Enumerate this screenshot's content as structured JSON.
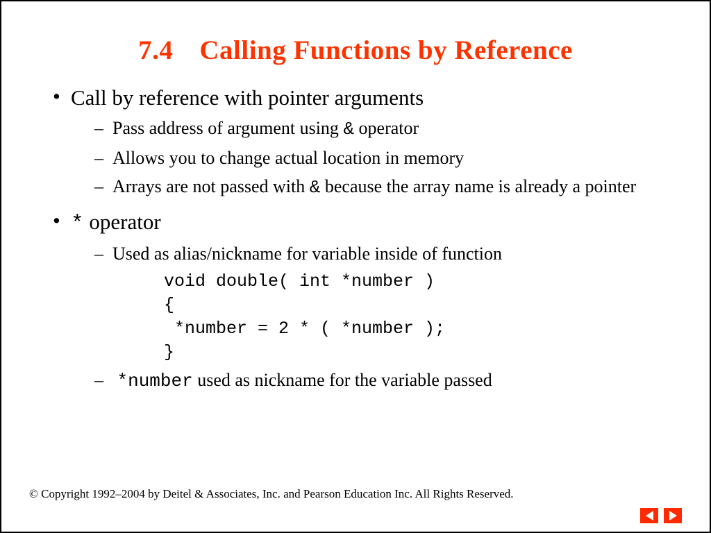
{
  "title": {
    "num": "7.4",
    "text": "Calling Functions by Reference"
  },
  "b1": {
    "head": "Call by reference with pointer arguments",
    "s1a": "Pass address of argument using ",
    "s1b": "&",
    "s1c": " operator",
    "s2": "Allows you to change actual location in memory",
    "s3a": "Arrays are not passed with ",
    "s3b": "&",
    "s3c": " because the array name is already a pointer"
  },
  "b2": {
    "op": "*",
    "head": " operator",
    "s1": "Used as alias/nickname for variable inside of function",
    "code": "void double( int *number )\n{\n *number = 2 * ( *number );\n}",
    "s2a": "*number",
    "s2b": " used as nickname for the variable passed"
  },
  "footer": "© Copyright 1992–2004 by Deitel & Associates, Inc. and Pearson Education Inc. All Rights Reserved."
}
